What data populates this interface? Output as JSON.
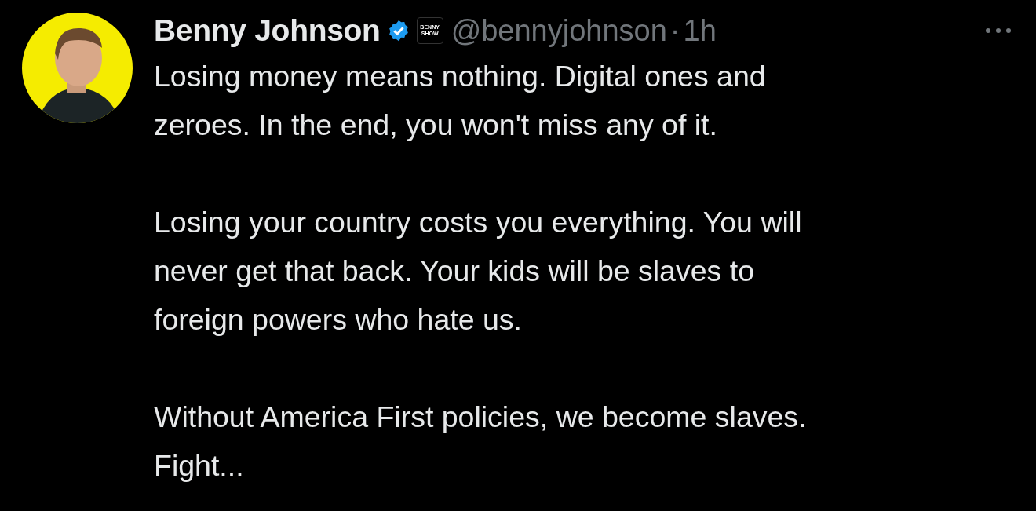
{
  "tweet": {
    "author": {
      "name": "Benny Johnson",
      "verified": true,
      "affiliate_badge": [
        "BENNY",
        "SHOW"
      ],
      "handle": "@bennyjohnson",
      "separator": "·",
      "time": "1h"
    },
    "paragraphs": [
      {
        "lines": [
          "Losing money means nothing. Digital ones and",
          "zeroes. In the end, you won't miss any of it."
        ]
      },
      {
        "lines": [
          "Losing your country costs you everything. You will",
          "never get that back. Your kids will be slaves to",
          "foreign powers who hate us."
        ]
      },
      {
        "lines": [
          "Without America First policies, we become slaves.",
          "Fight..."
        ]
      }
    ]
  }
}
